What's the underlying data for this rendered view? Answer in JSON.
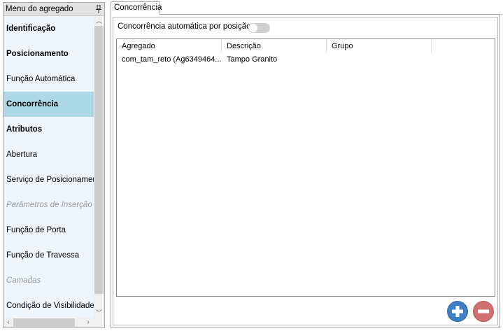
{
  "menu": {
    "title": "Menu do agregado",
    "items": [
      {
        "label": "Identificação",
        "bold": true,
        "disabled": false,
        "selected": false
      },
      {
        "label": "Posicionamento",
        "bold": true,
        "disabled": false,
        "selected": false
      },
      {
        "label": "Função Automática",
        "bold": false,
        "disabled": false,
        "selected": false
      },
      {
        "label": "Concorrência",
        "bold": true,
        "disabled": false,
        "selected": true
      },
      {
        "label": "Atributos",
        "bold": true,
        "disabled": false,
        "selected": false
      },
      {
        "label": "Abertura",
        "bold": false,
        "disabled": false,
        "selected": false
      },
      {
        "label": "Serviço de Posicionamento",
        "bold": false,
        "disabled": false,
        "selected": false
      },
      {
        "label": "Parâmetros de Inserção",
        "bold": false,
        "disabled": true,
        "selected": false
      },
      {
        "label": "Função de Porta",
        "bold": false,
        "disabled": false,
        "selected": false
      },
      {
        "label": "Função de Travessa",
        "bold": false,
        "disabled": false,
        "selected": false
      },
      {
        "label": "Camadas",
        "bold": false,
        "disabled": true,
        "selected": false
      },
      {
        "label": "Condição de Visibilidade",
        "bold": false,
        "disabled": false,
        "selected": false
      }
    ]
  },
  "tab": {
    "label": "Concorrência"
  },
  "toggle": {
    "label": "Concorrência automática por posição",
    "on": false
  },
  "grid": {
    "columns": [
      "Agregado",
      "Descrição",
      "Grupo"
    ],
    "rows": [
      [
        "com_tam_reto (Ag6349464...",
        "Tampo Granito",
        ""
      ]
    ]
  },
  "colors": {
    "selected_bg": "#add8e6",
    "menu_bg": "#eef6fc",
    "add_button": "#3f7fc4",
    "remove_button": "#d07070"
  }
}
